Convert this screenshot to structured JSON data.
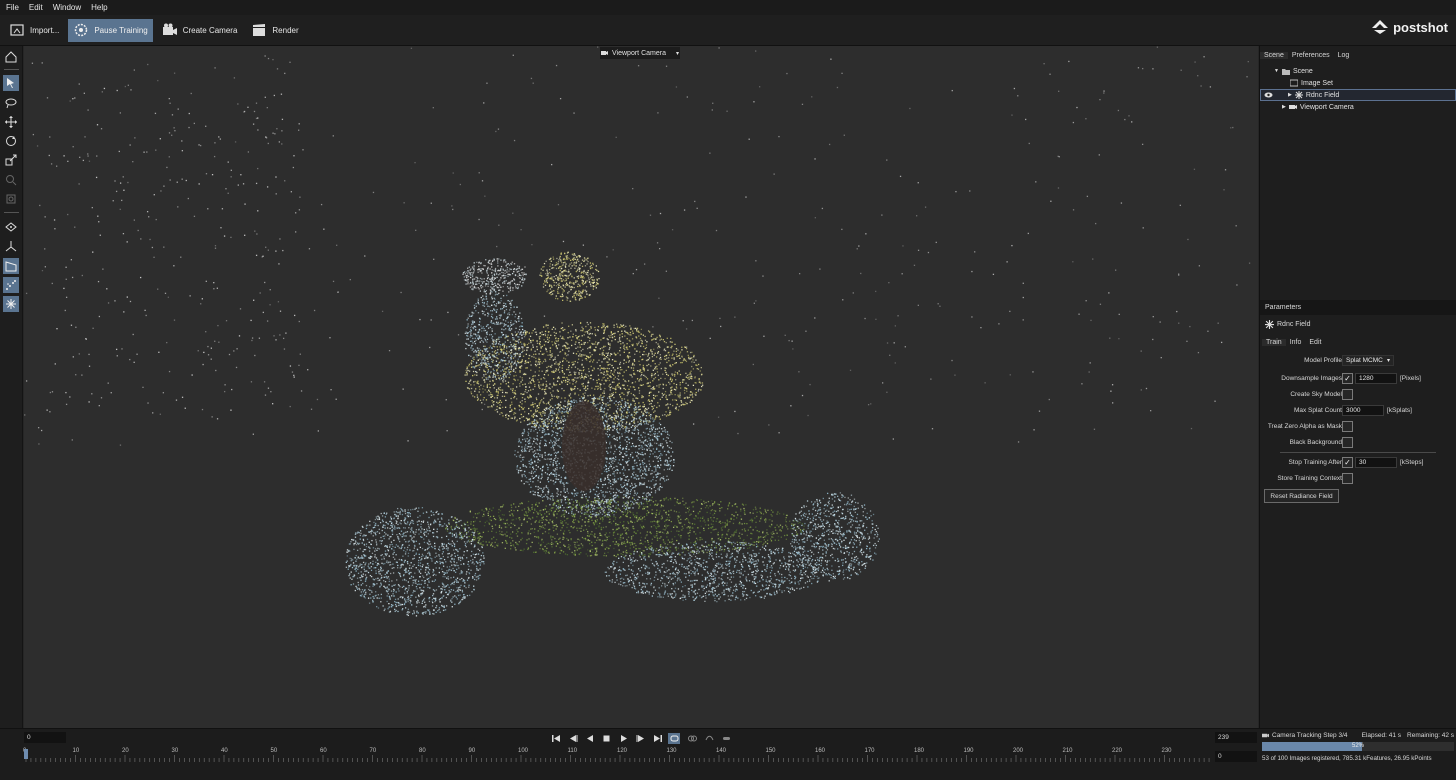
{
  "menu": [
    "File",
    "Edit",
    "Window",
    "Help"
  ],
  "toolbar": {
    "import": "Import...",
    "pause": "Pause Training",
    "create_camera": "Create Camera",
    "render": "Render"
  },
  "logo": "postshot",
  "viewport": {
    "camera_label": "Viewport Camera"
  },
  "scene_tabs": [
    "Scene",
    "Preferences",
    "Log"
  ],
  "scene_tree": {
    "root": "Scene",
    "image_set": "Image Set",
    "radiance": "Rdnc Field",
    "viewport_camera": "Viewport Camera"
  },
  "params": {
    "header": "Parameters",
    "object": "Rdnc Field",
    "tabs": [
      "Train",
      "Info",
      "Edit"
    ],
    "model_profile_label": "Model Profile",
    "model_profile_value": "Splat MCMC",
    "downsample_label": "Downsample Images",
    "downsample_value": "1280",
    "downsample_unit": "[Pixels]",
    "sky_label": "Create Sky Model",
    "max_splat_label": "Max Splat Count",
    "max_splat_value": "3000",
    "max_splat_unit": "[kSplats]",
    "zero_alpha_label": "Treat Zero Alpha as Mask",
    "black_bg_label": "Black Background",
    "stop_label": "Stop Training After",
    "stop_value": "30",
    "stop_unit": "[kSteps]",
    "store_label": "Store Training Context",
    "reset_button": "Reset Radiance Field"
  },
  "timeline": {
    "start_frame": "0",
    "current_frame": "239",
    "end_frame": "0",
    "ticks": [
      "0",
      "10",
      "20",
      "30",
      "40",
      "50",
      "60",
      "70",
      "80",
      "90",
      "100",
      "110",
      "120",
      "130",
      "140",
      "150",
      "160",
      "170",
      "180",
      "190",
      "200",
      "210",
      "220",
      "230"
    ]
  },
  "status": {
    "step": "Camera Tracking Step 3/4",
    "elapsed": "Elapsed: 41 s",
    "remaining": "Remaining: 42 s",
    "progress_label": "52%",
    "progress": 0.52,
    "detail": "53 of 100 Images registered, 785.31 kFeatures, 26.95 kPoints"
  },
  "colors": {
    "accent": "#5a7490",
    "panel": "#1e1e1e",
    "viewport": "#2d2d2d"
  }
}
